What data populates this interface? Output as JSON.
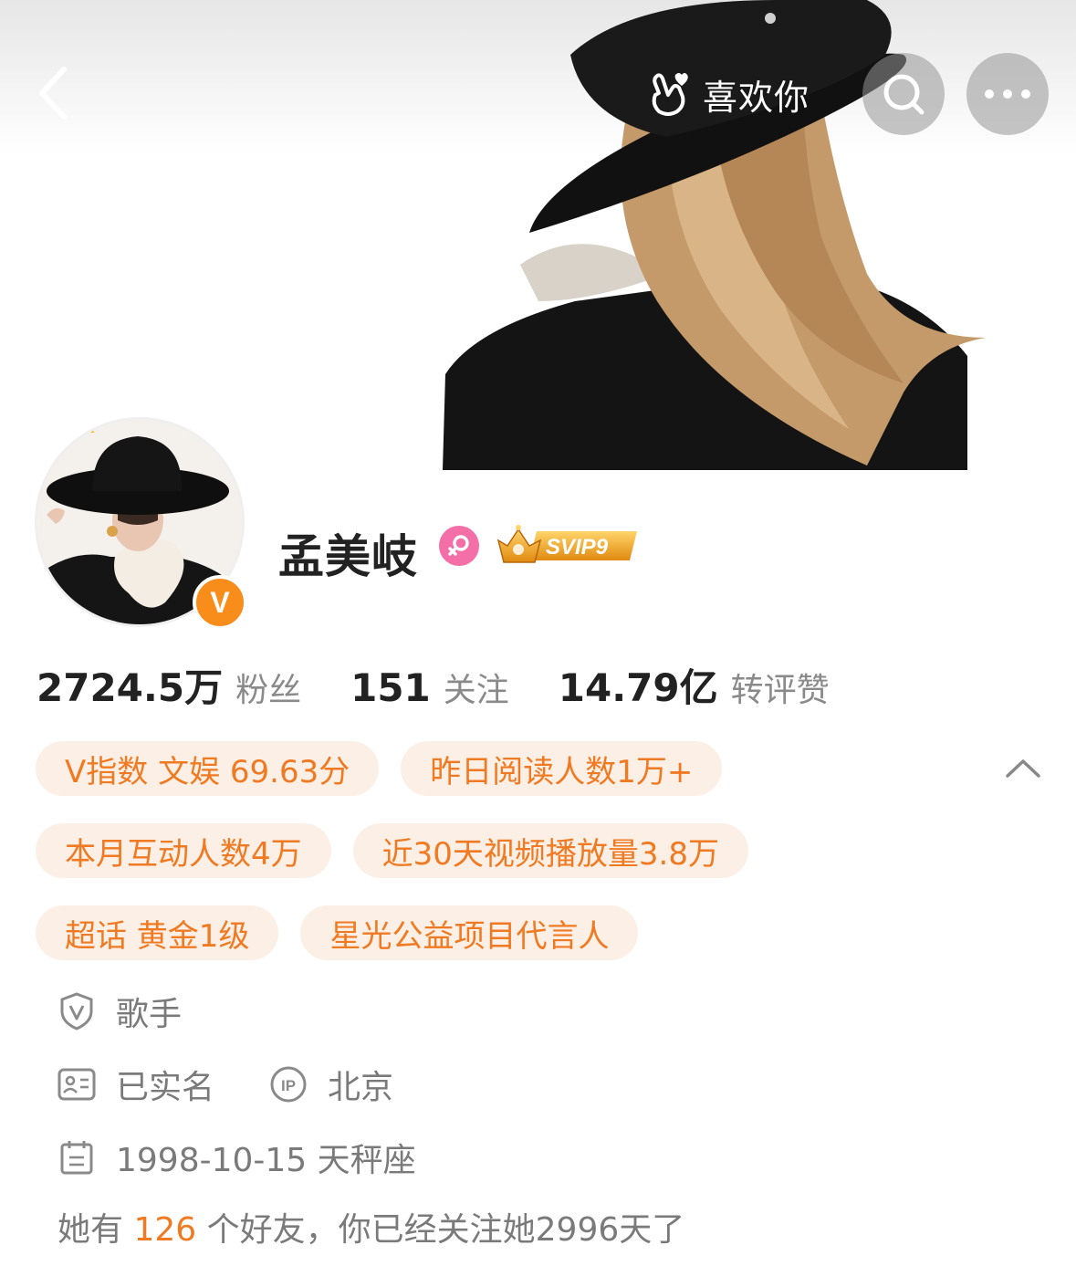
{
  "header": {
    "like_label": "喜欢你",
    "icons": [
      "back-arrow-icon",
      "hand-heart-icon",
      "search-icon",
      "more-icon"
    ]
  },
  "profile": {
    "name": "孟美岐",
    "svip_label": "SVIP9",
    "verified_badge": "V"
  },
  "stats": [
    {
      "value": "2724.5万",
      "label": "粉丝"
    },
    {
      "value": "151",
      "label": "关注"
    },
    {
      "value": "14.79亿",
      "label": "转评赞"
    }
  ],
  "tags": [
    "V指数 文娱 69.63分",
    "昨日阅读人数1万+",
    "本月互动人数4万",
    "近30天视频播放量3.8万",
    "超话 黄金1级",
    "星光公益项目代言人"
  ],
  "info": {
    "occupation": "歌手",
    "realname": "已实名",
    "ip_location": "北京",
    "birthday": "1998-10-15 天秤座"
  },
  "friends": {
    "prefix": "她有",
    "count": "126",
    "suffix": "个好友，你已经关注她",
    "days": "2996",
    "days_suffix": "天了"
  },
  "colors": {
    "accent": "#f07a22",
    "tag_bg": "#fcefe6",
    "verified": "#f88d1b",
    "female": "#f46ea8"
  }
}
